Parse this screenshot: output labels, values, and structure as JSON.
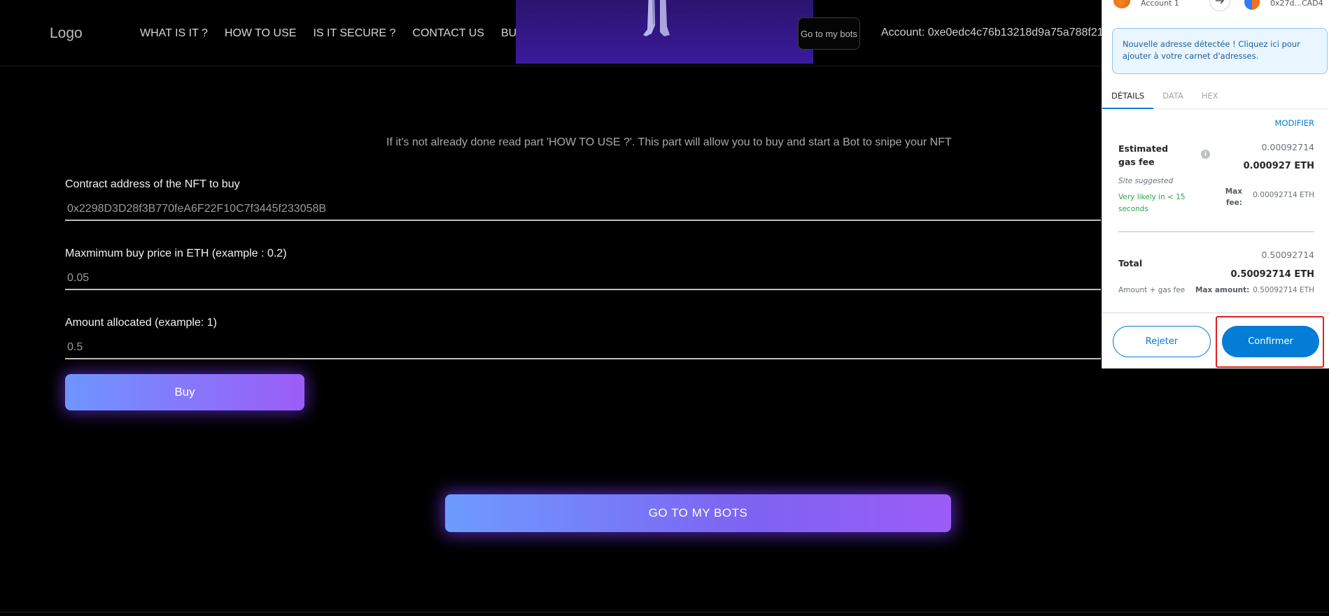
{
  "header": {
    "logo": "Logo",
    "nav": [
      "WHAT IS IT ?",
      "HOW TO USE",
      "IS IT SECURE ?",
      "CONTACT US",
      "BUY A BOT"
    ],
    "goto_bots_small": "Go to my bots",
    "account": "Account: 0xe0edc4c76b13218d9a75a788f21"
  },
  "form": {
    "intro": "If it's not already done read part 'HOW TO USE ?'. This part will allow you to buy and start a Bot to snipe your NFT",
    "contract_label": "Contract address of the NFT to buy",
    "contract_value": "0x2298D3D28f3B770feA6F22F10C7f3445f233058B",
    "max_price_label": "Maxmimum buy price in ETH (example : 0.2)",
    "max_price_value": "0.05",
    "amount_label": "Amount allocated (example: 1)",
    "amount_value": "0.5",
    "buy_button": "Buy",
    "goto_bots_button": "GO TO MY BOTS"
  },
  "metamask": {
    "account_name": "Account 1",
    "destination": "0x27d...CAD4",
    "notice": "Nouvelle adresse détectée ! Cliquez ici pour ajouter à votre carnet d'adresses.",
    "tabs": [
      "DÉTAILS",
      "DATA",
      "HEX"
    ],
    "modifier": "MODIFIER",
    "gas_title": "Estimated gas fee",
    "gas_small": "0.00092714",
    "gas_bold": "0.000927 ETH",
    "site_suggested": "Site suggested",
    "likely": "Very likely in < 15 seconds",
    "max_fee_label": "Max fee:",
    "max_fee_value": "0.00092714 ETH",
    "total_label": "Total",
    "total_small": "0.50092714",
    "total_bold": "0.50092714 ETH",
    "amount_gas": "Amount + gas fee",
    "max_amount_label": "Max amount:",
    "max_amount_value": "0.50092714 ETH",
    "reject": "Rejeter",
    "confirm": "Confirmer"
  },
  "colors": {
    "accent_blue": "#037dd6",
    "gradient_start": "#6e95ff",
    "gradient_end": "#9c5cf7",
    "highlight": "#e51f1f",
    "success": "#28a745"
  }
}
